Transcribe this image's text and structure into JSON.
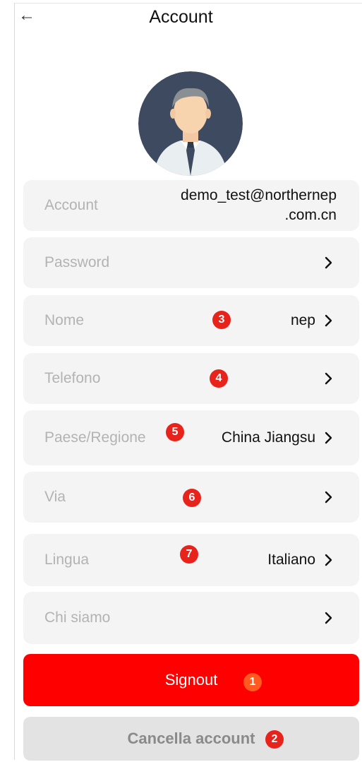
{
  "header": {
    "back_icon": "arrow-left-icon",
    "title": "Account"
  },
  "profile": {
    "avatar_icon": "user-avatar-icon"
  },
  "settings": {
    "account": {
      "label": "Account",
      "value_line1": "demo_test@northernep",
      "value_line2": ".com.cn"
    },
    "password": {
      "label": "Password",
      "value": ""
    },
    "nome": {
      "label": "Nome",
      "value": "nep",
      "badge": "3"
    },
    "telefono": {
      "label": "Telefono",
      "value": "",
      "badge": "4"
    },
    "paese": {
      "label": "Paese/Regione",
      "value": "China Jiangsu",
      "badge": "5"
    },
    "via": {
      "label": "Via",
      "value": "",
      "badge": "6"
    },
    "lingua": {
      "label": "Lingua",
      "value": "Italiano",
      "badge": "7"
    },
    "chi_siamo": {
      "label": "Chi siamo",
      "value": ""
    }
  },
  "actions": {
    "signout_label": "Signout",
    "signout_badge": "1",
    "cancel_label": "Cancella account",
    "cancel_badge": "2"
  },
  "colors": {
    "primary_red": "#ff0000",
    "badge_red": "#e8231c",
    "row_bg": "#f4f4f4",
    "label_gray": "#b3b3b3"
  }
}
